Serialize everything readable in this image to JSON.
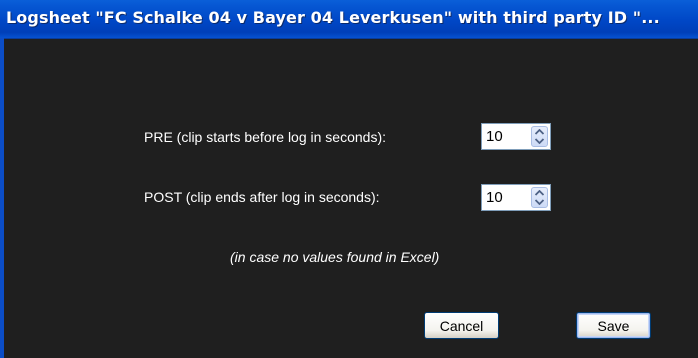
{
  "window": {
    "title": "Logsheet \"FC Schalke 04 v Bayer 04 Leverkusen\" with third party ID \"..."
  },
  "form": {
    "pre": {
      "label": "PRE (clip starts before log in seconds):",
      "value": "10"
    },
    "post": {
      "label": "POST (clip ends after log in seconds):",
      "value": "10"
    },
    "note": "(in case no values found in Excel)"
  },
  "buttons": {
    "cancel": "Cancel",
    "save": "Save"
  },
  "icons": {
    "spin_up": "arrow-up-icon",
    "spin_down": "arrow-down-icon"
  },
  "colors": {
    "titlebar": "#0047c6",
    "background": "#1f1f1f"
  }
}
